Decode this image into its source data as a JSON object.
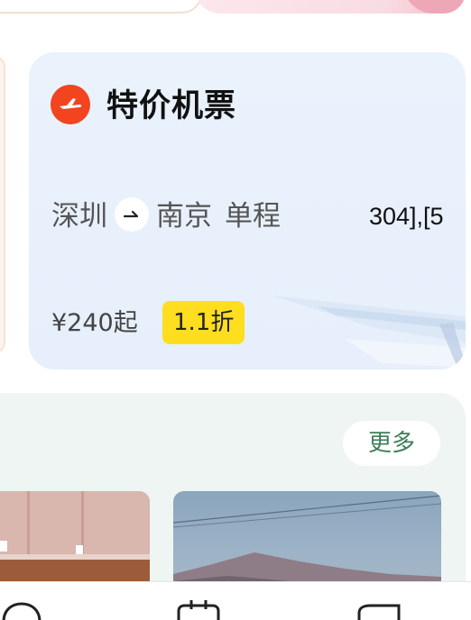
{
  "flight_card": {
    "title": "特价机票",
    "route": {
      "from": "深圳",
      "to": "南京",
      "trip_type": "单程"
    },
    "code_fragment": "304],[5",
    "price": "¥240起",
    "discount": "1.1折"
  },
  "recommendations": {
    "more_label": "更多"
  },
  "colors": {
    "accent_orange": "#f1441f",
    "discount_yellow": "#ffdd1f",
    "more_green": "#3f7f5a",
    "card_blue": "#e8f1fc"
  },
  "icons": {
    "flight": "airplane-icon",
    "route_arrow": "arrow-right-icon",
    "tabs": [
      "chat-icon",
      "bag-icon",
      "card-icon"
    ]
  }
}
